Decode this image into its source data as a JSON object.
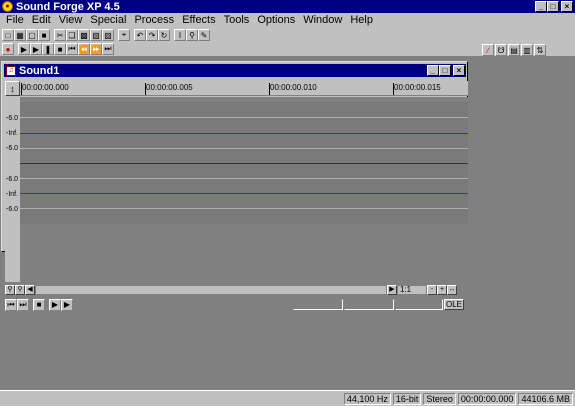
{
  "app": {
    "title": "Sound Forge XP 4.5",
    "min": "_",
    "restore": "□",
    "close": "×"
  },
  "menu": [
    "File",
    "Edit",
    "View",
    "Special",
    "Process",
    "Effects",
    "Tools",
    "Options",
    "Window",
    "Help"
  ],
  "document": {
    "title": "Sound1",
    "ruler_labels": [
      "00:00:00.000",
      "00:00:00.005",
      "00:00:00.010",
      "00:00:00.015"
    ],
    "scale_labels": [
      "-6.0",
      "-Inf.",
      "-6.0",
      "-6.0",
      "-Inf.",
      "-6.0"
    ],
    "zoom_ratio": "1:1",
    "ole_label": "OLE"
  },
  "status": {
    "sample_rate": "44,100 Hz",
    "bit_depth": "16-bit",
    "channels": "Stereo",
    "position": "00:00:00.000",
    "free_space": "44106.6 MB"
  },
  "colors": {
    "titlebar": "#000080",
    "waveform_center": "#3030c0",
    "wave_bg": "#808080"
  }
}
